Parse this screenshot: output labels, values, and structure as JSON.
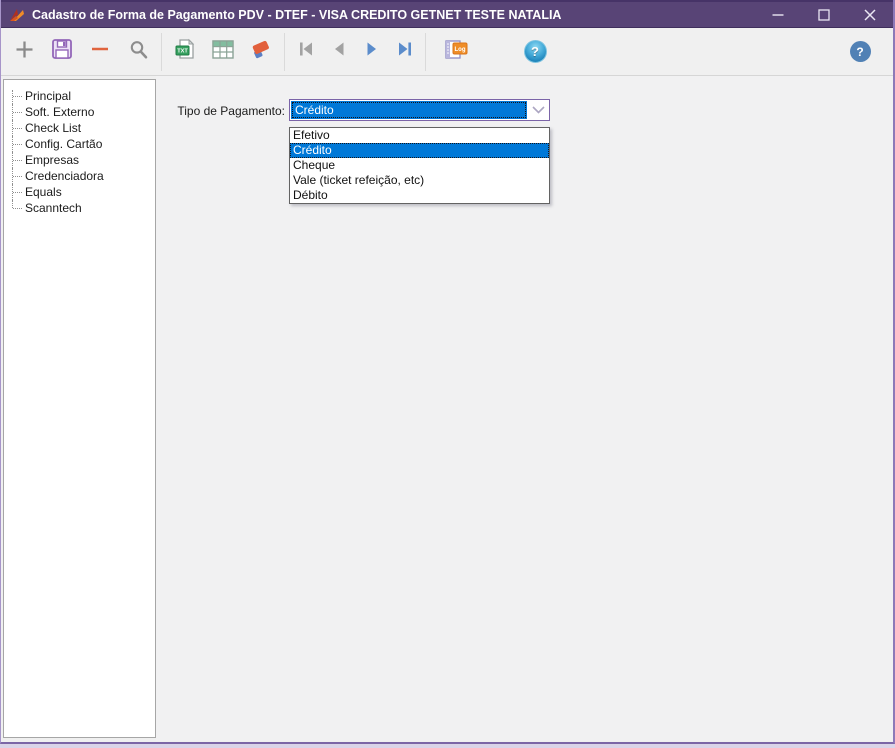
{
  "window": {
    "title": "Cadastro de Forma de Pagamento PDV - DTEF - VISA CREDITO GETNET TESTE NATALIA",
    "control_icons": [
      "minimize-icon",
      "maximize-icon",
      "close-icon"
    ],
    "app_icon": "flame-bolt-icon"
  },
  "colors": {
    "titlebar": "#584476",
    "window_border": "#8d79b8",
    "selection_highlight": "#0078d7",
    "combo_border": "#7b64a8",
    "toolbar_bg": "#f0f0f0",
    "main_bg": "#f1f1f2"
  },
  "toolbar": {
    "icons": [
      "plus-icon",
      "save-floppy-icon",
      "minus-icon",
      "search-icon",
      "txt-file-icon",
      "table-grid-icon",
      "eraser-icon",
      "nav-first-icon",
      "nav-prev-icon",
      "nav-next-icon",
      "nav-last-icon",
      "log-book-icon",
      "help-icon",
      "help-icon"
    ],
    "help_glyph": "?"
  },
  "sidebar": {
    "items": [
      "Principal",
      "Soft. Externo",
      "Check List",
      "Config. Cartão",
      "Empresas",
      "Credenciadora",
      "Equals",
      "Scanntech"
    ]
  },
  "main": {
    "field_label": "Tipo de Pagamento:",
    "combo_value": "Crédito",
    "dropdown": {
      "options": [
        "Efetivo",
        "Crédito",
        "Cheque",
        "Vale (ticket refeição, etc)",
        "Débito"
      ],
      "selected_index": 1
    }
  }
}
